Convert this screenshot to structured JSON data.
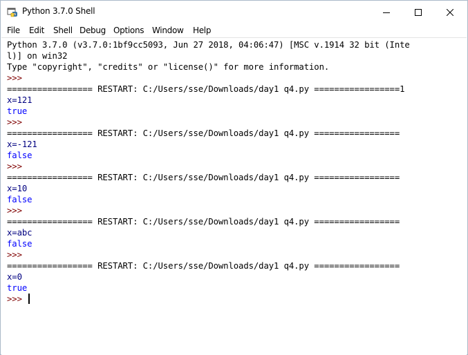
{
  "window": {
    "title": "Python 3.7.0 Shell"
  },
  "menu": {
    "items": [
      "File",
      "Edit",
      "Shell",
      "Debug",
      "Options",
      "Window",
      "Help"
    ]
  },
  "shell": {
    "lines": [
      {
        "text": "Python 3.7.0 (v3.7.0:1bf9cc5093, Jun 27 2018, 04:06:47) [MSC v.1914 32 bit (Inte",
        "kind": "out"
      },
      {
        "text": "l)] on win32",
        "kind": "out"
      },
      {
        "text": "Type \"copyright\", \"credits\" or \"license()\" for more information.",
        "kind": "out"
      },
      {
        "text": ">>> ",
        "kind": "prompt"
      },
      {
        "text": "================= RESTART: C:/Users/sse/Downloads/day1 q4.py =================1",
        "kind": "out"
      },
      {
        "text": "x=121",
        "kind": "in"
      },
      {
        "text": "true",
        "kind": "stdout"
      },
      {
        "text": ">>> ",
        "kind": "prompt"
      },
      {
        "text": "================= RESTART: C:/Users/sse/Downloads/day1 q4.py =================",
        "kind": "out"
      },
      {
        "text": "x=-121",
        "kind": "in"
      },
      {
        "text": "false",
        "kind": "stdout"
      },
      {
        "text": ">>> ",
        "kind": "prompt"
      },
      {
        "text": "================= RESTART: C:/Users/sse/Downloads/day1 q4.py =================",
        "kind": "out"
      },
      {
        "text": "x=10",
        "kind": "in"
      },
      {
        "text": "false",
        "kind": "stdout"
      },
      {
        "text": ">>> ",
        "kind": "prompt"
      },
      {
        "text": "================= RESTART: C:/Users/sse/Downloads/day1 q4.py =================",
        "kind": "out"
      },
      {
        "text": "x=abc",
        "kind": "in"
      },
      {
        "text": "false",
        "kind": "stdout"
      },
      {
        "text": ">>> ",
        "kind": "prompt"
      },
      {
        "text": "================= RESTART: C:/Users/sse/Downloads/day1 q4.py =================",
        "kind": "out"
      },
      {
        "text": "x=0",
        "kind": "in"
      },
      {
        "text": "true",
        "kind": "stdout"
      },
      {
        "text": ">>> ",
        "kind": "prompt"
      }
    ]
  },
  "colors": {
    "output": "#000000",
    "prompt": "#7f0000",
    "input": "#000080",
    "stdout": "#0000ff"
  },
  "icons": {
    "app": "python-icon",
    "minimize": "minimize-icon",
    "maximize": "maximize-icon",
    "close": "close-icon"
  }
}
